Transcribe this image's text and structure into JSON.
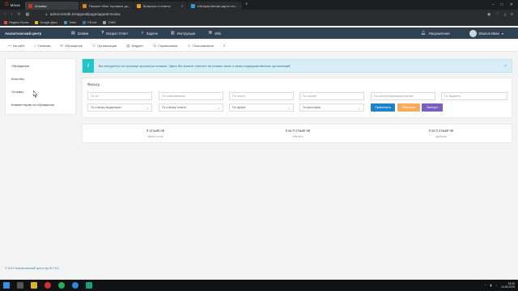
{
  "browser": {
    "menu_label": "Меню",
    "tabs": [
      {
        "title": "Отзывы",
        "color": "#c0392b"
      },
      {
        "title": "Письмо «Все торговые до...",
        "color": "#e67e22"
      },
      {
        "title": "Вопросы и ответы",
        "color": "#f39c12"
      },
      {
        "title": "Интерактивная карта отз...",
        "color": "#3498db"
      }
    ],
    "new_tab": "+",
    "window_controls": [
      "–",
      "□",
      "✕"
    ],
    "address": "admin.testdb.kz/appeal/page/appeal-review",
    "bookmarks": [
      {
        "label": "Яндекс.Почта",
        "color": "#e74c3c"
      },
      {
        "label": "Google Диск",
        "color": "#f1c40f"
      },
      {
        "label": "Trello",
        "color": "#3498db"
      },
      {
        "label": "FB bot",
        "color": "#2980b9"
      },
      {
        "label": "CMM",
        "color": "#95a5a6"
      }
    ]
  },
  "appnav": {
    "brand": "Аналитический центр",
    "items": [
      {
        "label": "Заявки",
        "icon": "doc-icon"
      },
      {
        "label": "Вопрос-Ответ",
        "icon": "question-icon"
      },
      {
        "label": "Задачи",
        "icon": "bolt-icon"
      },
      {
        "label": "Инструкции",
        "icon": "book-icon"
      },
      {
        "label": "Wiki",
        "icon": "wiki-icon"
      }
    ],
    "notifications": "Уведомления",
    "user": "Иванов Иван"
  },
  "subnav": {
    "items": [
      {
        "label": "На сайт",
        "icon": "↪"
      },
      {
        "label": "Главная",
        "icon": "⌂"
      },
      {
        "label": "Обращения",
        "icon": "✉"
      },
      {
        "label": "Организации",
        "icon": "☷"
      },
      {
        "label": "Бюджет",
        "icon": "▤"
      },
      {
        "label": "Справочники",
        "icon": "☰"
      },
      {
        "label": "Пользователи",
        "icon": "☺"
      }
    ],
    "more": "≡"
  },
  "sidebar": {
    "items": [
      {
        "label": "Обращения"
      },
      {
        "label": "Жалобы"
      },
      {
        "label": "Отзывы"
      },
      {
        "label": "Комментарии на обращения"
      }
    ]
  },
  "alert": {
    "icon": "i",
    "text": "Вы находитесь на странице просмотра отзывов. Здесь Вы можете ответить на отзывы своих и своих подведомственных организаций.",
    "close": "×"
  },
  "filter": {
    "title": "Фильтр",
    "placeholders": {
      "id": "По Id",
      "user": "По пользователю",
      "text": "По тексту",
      "org": "По органу",
      "control_org": "По контролирующему органу",
      "budget": "По бюджету"
    },
    "selects": {
      "moderation": "По статусу модерации",
      "answer": "По статусу ответа",
      "sphere": "По сфере",
      "category": "По категории"
    },
    "buttons": {
      "apply": "Применить",
      "reset": "Сбросить",
      "export": "Экспорт"
    },
    "colors": {
      "apply": "#1c84c6",
      "reset": "#f8ac59",
      "export": "#7b5cbf"
    }
  },
  "stats": [
    {
      "value": "0 отзыв/-ов",
      "label": "общее кол-во"
    },
    {
      "value": "0 из 0 отзыв/-ов",
      "label": "отвечено"
    },
    {
      "value": "0 из 0 отзыв/-ов",
      "label": "одобрено"
    }
  ],
  "footer": {
    "prefix": "© 2019",
    "link": "Аналитический центр by GLT KZ"
  },
  "taskbar": {
    "icons": [
      {
        "name": "windows-icon",
        "color": "#3c8dde"
      },
      {
        "name": "search-icon",
        "color": "#555"
      },
      {
        "name": "explorer-icon",
        "color": "#e1b12c"
      },
      {
        "name": "opera-icon",
        "color": "#d63031"
      },
      {
        "name": "whatsapp-icon",
        "color": "#27ae60"
      },
      {
        "name": "telegram-icon",
        "color": "#2e86de"
      },
      {
        "name": "app-icon",
        "color": "#16a085"
      }
    ],
    "time": "15:26",
    "date": "14.06.2019"
  }
}
